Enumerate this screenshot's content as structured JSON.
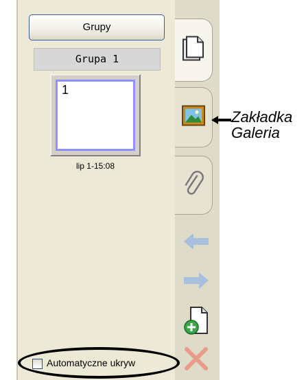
{
  "panel": {
    "groups_button_label": "Grupy",
    "group_name": "Grupa 1",
    "page_thumbnail": {
      "number": "1",
      "caption": "lip 1-15:08"
    },
    "auto_hide_label": "Automatyczne ukryw"
  },
  "tabs": [
    {
      "name": "pages",
      "icon": "page-icon",
      "active": true
    },
    {
      "name": "gallery",
      "icon": "gallery-picture-icon",
      "active": false
    },
    {
      "name": "attachments",
      "icon": "paperclip-icon",
      "active": false
    }
  ],
  "nav_icons": [
    "back-arrow-icon",
    "forward-arrow-icon",
    "add-page-icon",
    "delete-icon"
  ],
  "annotation": {
    "line1": "Zakładka",
    "line2": "Galeria"
  },
  "colors": {
    "panel_bg": "#ece9d6",
    "tabstrip_bg": "#dedbc9",
    "thumb_border": "#8f8fff",
    "disabled_arrow": "#a8c0de",
    "delete_x": "#e89b8b"
  }
}
